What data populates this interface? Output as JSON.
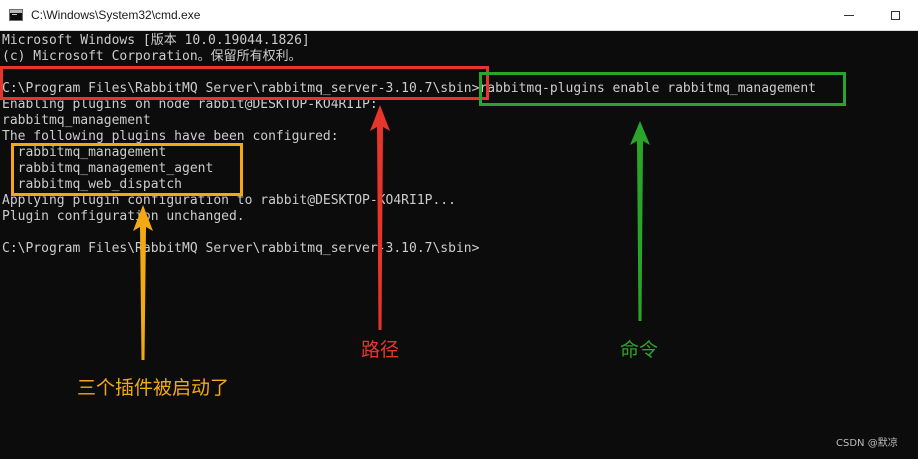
{
  "window": {
    "title": "C:\\Windows\\System32\\cmd.exe",
    "close_glyph": "✕"
  },
  "console": {
    "lines": [
      "Microsoft Windows [版本 10.0.19044.1826]",
      "(c) Microsoft Corporation。保留所有权利。",
      "",
      "C:\\Program Files\\RabbitMQ Server\\rabbitmq_server-3.10.7\\sbin>",
      "Enabling plugins on node rabbit@DESKTOP-KO4RI1P:",
      "rabbitmq_management",
      "The following plugins have been configured:",
      "  rabbitmq_management",
      "  rabbitmq_management_agent",
      "  rabbitmq_web_dispatch",
      "Applying plugin configuration to rabbit@DESKTOP-KO4RI1P...",
      "Plugin configuration unchanged.",
      "",
      "C:\\Program Files\\RabbitMQ Server\\rabbitmq_server-3.10.7\\sbin>"
    ],
    "command": "rabbitmq-plugins enable rabbitmq_management"
  },
  "annotations": {
    "path_label": "路径",
    "command_label": "命令",
    "plugins_label": "三个插件被启动了",
    "colors": {
      "red": "#e8352c",
      "green": "#2aa52a",
      "orange": "#f2a913"
    }
  },
  "watermark": "CSDN @默凉"
}
